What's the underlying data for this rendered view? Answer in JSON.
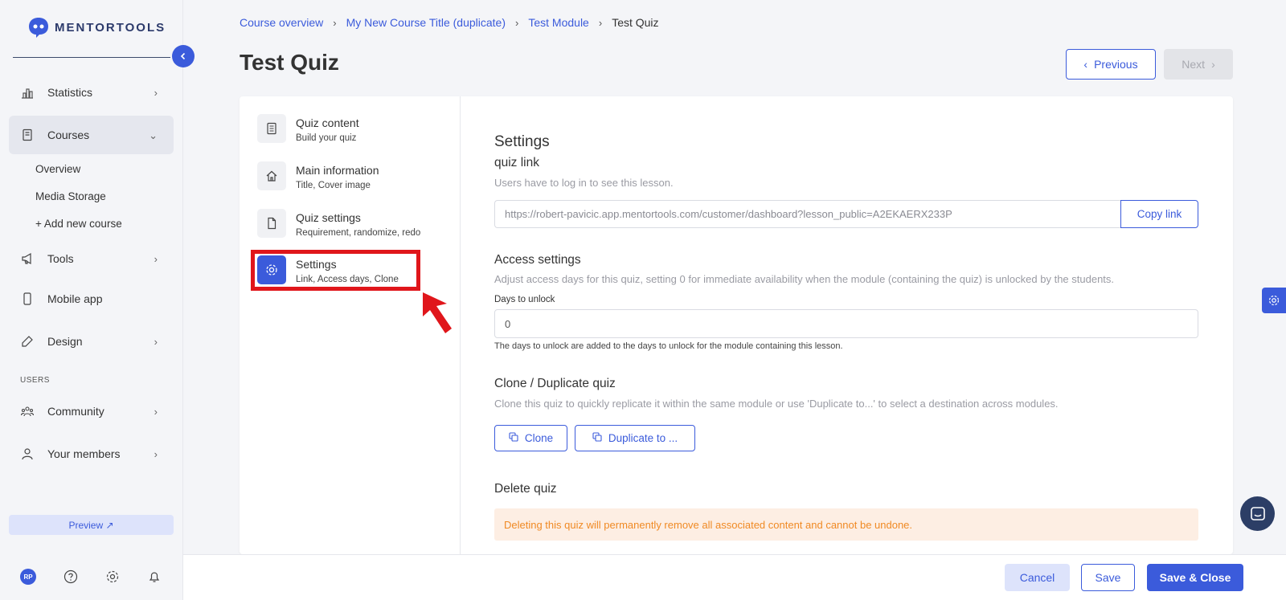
{
  "brand": {
    "name": "MENTORTOOLS",
    "accent": "#3b5bdb",
    "highlight": "#e0161b",
    "warning_text": "#f08a24"
  },
  "sidebar": {
    "items": [
      {
        "label": "Statistics",
        "icon": "bar-chart-icon"
      },
      {
        "label": "Courses",
        "icon": "book-icon"
      },
      {
        "label": "Tools",
        "icon": "megaphone-icon"
      },
      {
        "label": "Mobile app",
        "icon": "phone-icon"
      },
      {
        "label": "Design",
        "icon": "pencil-icon"
      },
      {
        "label": "Community",
        "icon": "people-icon"
      },
      {
        "label": "Your members",
        "icon": "user-icon"
      }
    ],
    "courses_sub": [
      "Overview",
      "Media Storage",
      "+ Add new course"
    ],
    "section_users": "USERS",
    "preview_label": "Preview ↗",
    "avatar_initials": "RP"
  },
  "breadcrumb": [
    "Course overview",
    "My New Course Title (duplicate)",
    "Test Module",
    "Test Quiz"
  ],
  "page_title": "Test Quiz",
  "nav_buttons": {
    "previous": "Previous",
    "next": "Next"
  },
  "quiz_menu": [
    {
      "title": "Quiz content",
      "subtitle": "Build your quiz"
    },
    {
      "title": "Main information",
      "subtitle": "Title, Cover image"
    },
    {
      "title": "Quiz settings",
      "subtitle": "Requirement, randomize, redo"
    },
    {
      "title": "Settings",
      "subtitle": "Link, Access days, Clone"
    }
  ],
  "settings": {
    "heading": "Settings",
    "quiz_link": {
      "title": "quiz link",
      "description": "Users have to log in to see this lesson.",
      "url": "https://robert-pavicic.app.mentortools.com/customer/dashboard?lesson_public=A2EKAERX233P",
      "copy_label": "Copy link"
    },
    "access": {
      "title": "Access settings",
      "description": "Adjust access days for this quiz, setting 0 for immediate availability when the module (containing the quiz) is unlocked by the students.",
      "days_label": "Days to unlock",
      "days_value": "0",
      "hint": "The days to unlock are added to the days to unlock for the module containing this lesson."
    },
    "clone": {
      "title": "Clone / Duplicate quiz",
      "description": "Clone this quiz to quickly replicate it within the same module or use 'Duplicate to...' to select a destination across modules.",
      "clone_label": "Clone",
      "duplicate_label": "Duplicate to ..."
    },
    "delete": {
      "title": "Delete quiz",
      "warning": "Deleting this quiz will permanently remove all associated content and cannot be undone."
    }
  },
  "footer": {
    "cancel": "Cancel",
    "save": "Save",
    "save_close": "Save & Close"
  }
}
